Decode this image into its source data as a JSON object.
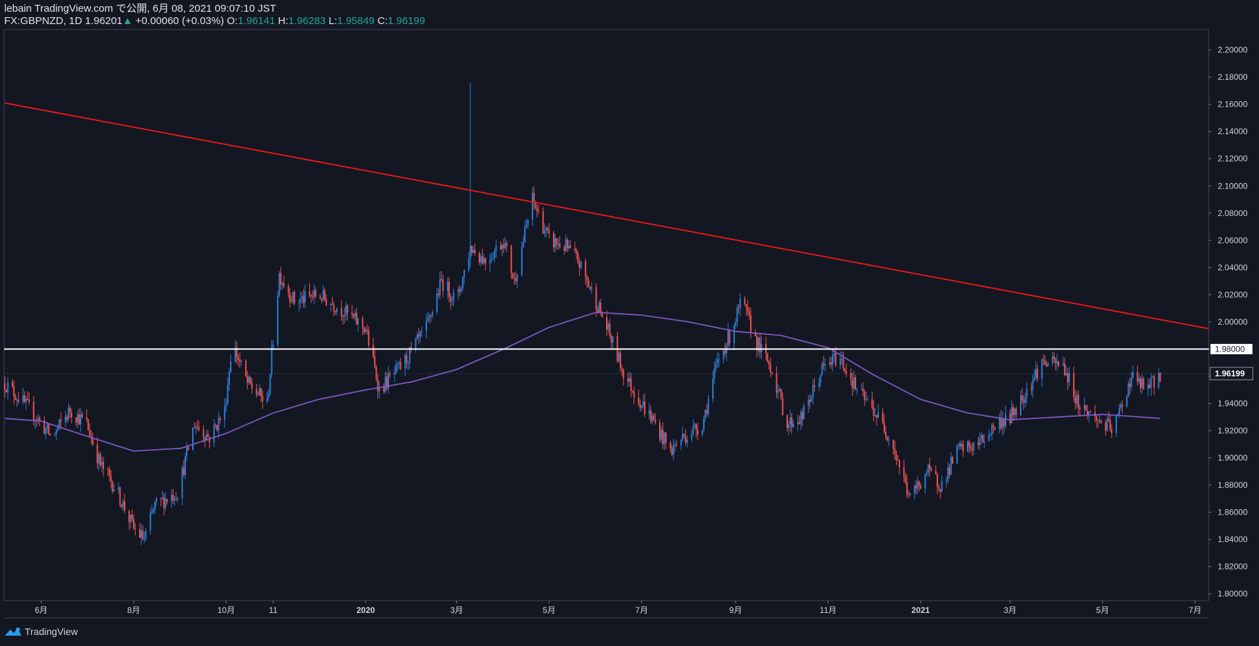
{
  "header": {
    "line1": "lebain TradingView.com で公開, 6月 08, 2021 09:07:10 JST",
    "symbol": "FX:GBPNZD, 1D",
    "last": "1.96201",
    "arrow": "▲",
    "change": "+0.00060 (+0.03%)",
    "o_label": "O:",
    "o_val": "1.96141",
    "h_label": "H:",
    "h_val": "1.96283",
    "l_label": "L:",
    "l_val": "1.95849",
    "c_label": "C:",
    "c_val": "1.96199"
  },
  "footer": {
    "brand": "TradingView"
  },
  "colors": {
    "background": "#131722",
    "up_candle": "#2b7fd6",
    "down_candle": "#ef5350",
    "trendline": "#e01919",
    "ma": "#7e57c2",
    "hline": "#ffffff",
    "last_price_line": "#9598a1"
  },
  "chart_data": {
    "type": "candlestick",
    "y_ticks": [
      "2.20000",
      "2.18000",
      "2.16000",
      "2.14000",
      "2.12000",
      "2.10000",
      "2.08000",
      "2.06000",
      "2.04000",
      "2.02000",
      "2.00000",
      "1.98000",
      "1.96000",
      "1.94000",
      "1.92000",
      "1.90000",
      "1.88000",
      "1.86000",
      "1.84000",
      "1.82000",
      "1.80000"
    ],
    "x_ticks": [
      "6月",
      "8月",
      "10月",
      "11",
      "2020",
      "3月",
      "5月",
      "7月",
      "9月",
      "11月",
      "2021",
      "3月",
      "5月",
      "7月"
    ],
    "ylim": [
      1.795,
      2.215
    ],
    "price_labels": {
      "hline": "1.98000",
      "last": "1.96199"
    },
    "horizontal_line": 1.98,
    "last_price": 1.96199,
    "trendline": {
      "start": [
        "2019-05-08",
        2.161
      ],
      "end": [
        "2021-07-10",
        1.995
      ]
    },
    "ma_series": [
      [
        "2019-05-08",
        1.929
      ],
      [
        "2019-06-01",
        1.927
      ],
      [
        "2019-07-01",
        1.916
      ],
      [
        "2019-08-01",
        1.905
      ],
      [
        "2019-09-01",
        1.907
      ],
      [
        "2019-10-01",
        1.918
      ],
      [
        "2019-11-01",
        1.933
      ],
      [
        "2019-12-01",
        1.943
      ],
      [
        "2020-01-01",
        1.95
      ],
      [
        "2020-02-01",
        1.956
      ],
      [
        "2020-03-01",
        1.965
      ],
      [
        "2020-04-01",
        1.98
      ],
      [
        "2020-05-01",
        1.996
      ],
      [
        "2020-06-01",
        2.007
      ],
      [
        "2020-07-01",
        2.005
      ],
      [
        "2020-08-01",
        2.0
      ],
      [
        "2020-09-01",
        1.993
      ],
      [
        "2020-10-01",
        1.99
      ],
      [
        "2020-11-01",
        1.981
      ],
      [
        "2020-12-01",
        1.961
      ],
      [
        "2021-01-01",
        1.943
      ],
      [
        "2021-02-01",
        1.933
      ],
      [
        "2021-03-01",
        1.928
      ],
      [
        "2021-04-01",
        1.93
      ],
      [
        "2021-05-01",
        1.932
      ],
      [
        "2021-06-08",
        1.929
      ]
    ],
    "anchors": [
      [
        "2019-05-08",
        1.955
      ],
      [
        "2019-05-25",
        1.935
      ],
      [
        "2019-06-08",
        1.915
      ],
      [
        "2019-06-20",
        1.935
      ],
      [
        "2019-07-01",
        1.925
      ],
      [
        "2019-07-10",
        1.895
      ],
      [
        "2019-07-20",
        1.878
      ],
      [
        "2019-08-01",
        1.848
      ],
      [
        "2019-08-08",
        1.84
      ],
      [
        "2019-08-15",
        1.865
      ],
      [
        "2019-08-30",
        1.875
      ],
      [
        "2019-09-10",
        1.925
      ],
      [
        "2019-09-20",
        1.915
      ],
      [
        "2019-09-30",
        1.935
      ],
      [
        "2019-10-05",
        1.985
      ],
      [
        "2019-10-15",
        1.955
      ],
      [
        "2019-10-28",
        1.94
      ],
      [
        "2019-11-05",
        2.035
      ],
      [
        "2019-11-15",
        2.015
      ],
      [
        "2019-12-01",
        2.02
      ],
      [
        "2019-12-15",
        2.01
      ],
      [
        "2020-01-01",
        1.995
      ],
      [
        "2020-01-10",
        1.95
      ],
      [
        "2020-01-25",
        1.968
      ],
      [
        "2020-02-10",
        1.995
      ],
      [
        "2020-02-20",
        2.03
      ],
      [
        "2020-03-01",
        2.015
      ],
      [
        "2020-03-10",
        2.055
      ],
      [
        "2020-03-20",
        2.045
      ],
      [
        "2020-04-01",
        2.06
      ],
      [
        "2020-04-08",
        2.03
      ],
      [
        "2020-04-20",
        2.09
      ],
      [
        "2020-05-01",
        2.06
      ],
      [
        "2020-05-12",
        2.055
      ],
      [
        "2020-05-20",
        2.045
      ],
      [
        "2020-06-01",
        2.015
      ],
      [
        "2020-06-10",
        1.99
      ],
      [
        "2020-06-20",
        1.96
      ],
      [
        "2020-07-01",
        1.94
      ],
      [
        "2020-07-10",
        1.925
      ],
      [
        "2020-07-20",
        1.905
      ],
      [
        "2020-07-28",
        1.915
      ],
      [
        "2020-08-10",
        1.925
      ],
      [
        "2020-08-20",
        1.97
      ],
      [
        "2020-08-28",
        1.99
      ],
      [
        "2020-09-05",
        2.015
      ],
      [
        "2020-09-15",
        1.985
      ],
      [
        "2020-09-25",
        1.965
      ],
      [
        "2020-10-05",
        1.925
      ],
      [
        "2020-10-15",
        1.93
      ],
      [
        "2020-10-28",
        1.965
      ],
      [
        "2020-11-08",
        1.975
      ],
      [
        "2020-11-20",
        1.95
      ],
      [
        "2020-12-01",
        1.935
      ],
      [
        "2020-12-12",
        1.915
      ],
      [
        "2020-12-25",
        1.87
      ],
      [
        "2021-01-05",
        1.89
      ],
      [
        "2021-01-15",
        1.88
      ],
      [
        "2021-01-25",
        1.905
      ],
      [
        "2021-02-08",
        1.91
      ],
      [
        "2021-02-20",
        1.925
      ],
      [
        "2021-03-01",
        1.93
      ],
      [
        "2021-03-12",
        1.95
      ],
      [
        "2021-03-22",
        1.97
      ],
      [
        "2021-04-05",
        1.968
      ],
      [
        "2021-04-15",
        1.94
      ],
      [
        "2021-04-25",
        1.93
      ],
      [
        "2021-05-08",
        1.92
      ],
      [
        "2021-05-20",
        1.96
      ],
      [
        "2021-05-30",
        1.95
      ],
      [
        "2021-06-08",
        1.962
      ]
    ]
  }
}
